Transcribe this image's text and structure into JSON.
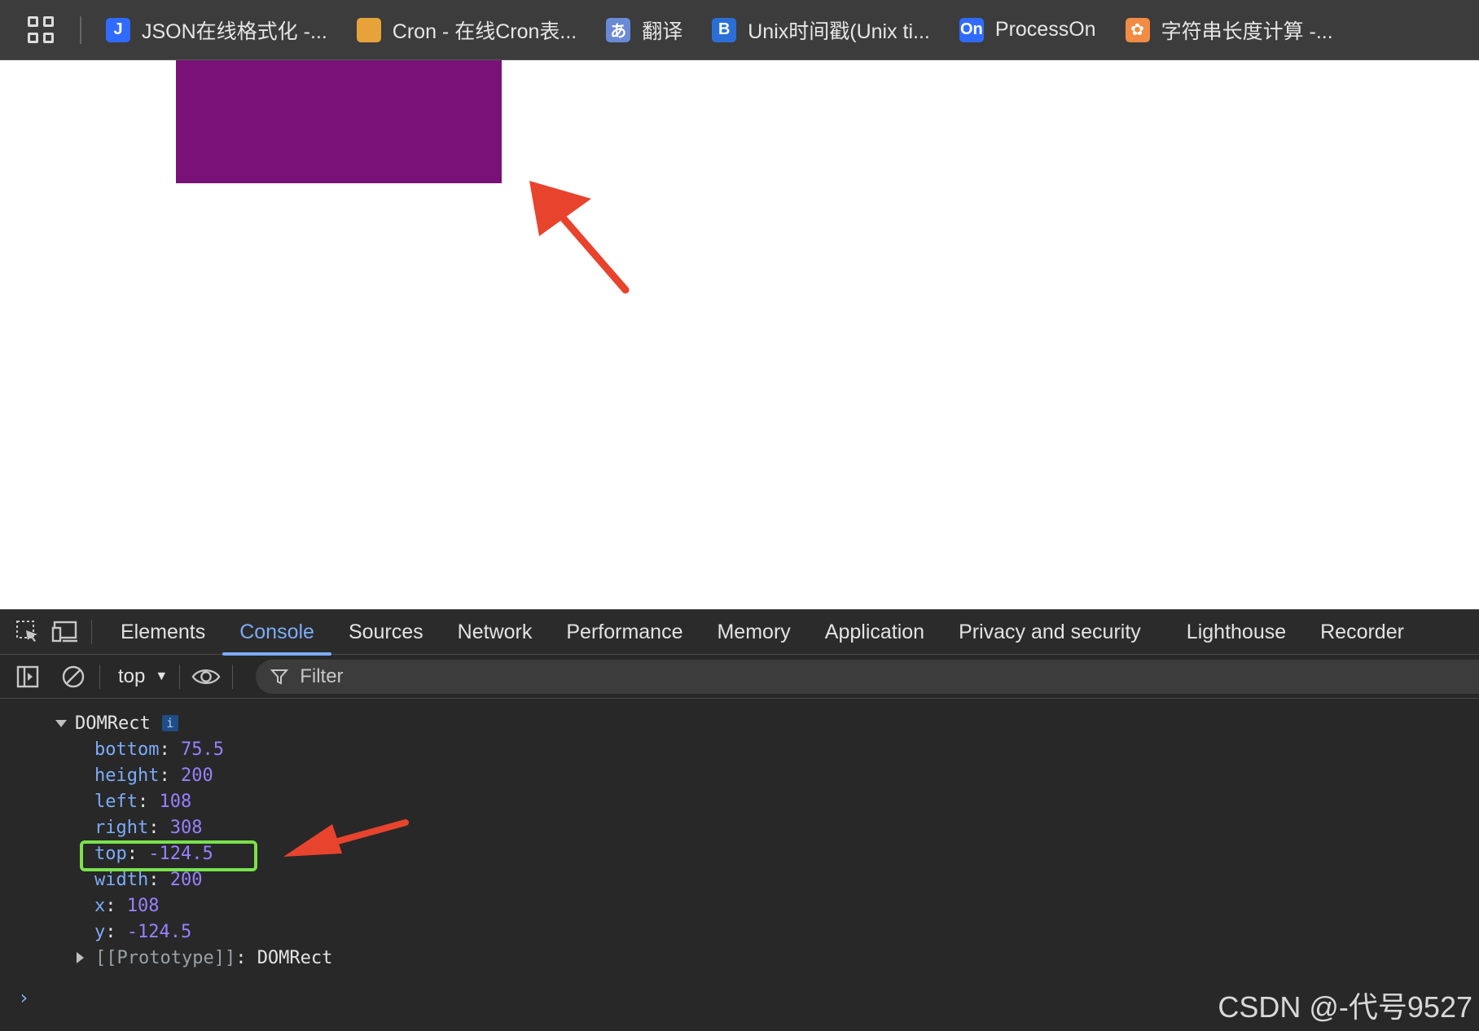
{
  "bookmarks": [
    {
      "label": "JSON在线格式化 -...",
      "icon": "j-logo-icon",
      "icon_text": "J",
      "color": "#2f6bff"
    },
    {
      "label": "Cron - 在线Cron表...",
      "icon": "cookie-icon",
      "icon_text": "",
      "color": "#e8a23a"
    },
    {
      "label": "翻译",
      "icon": "translate-icon",
      "icon_text": "あ",
      "color": "#6b8ad6"
    },
    {
      "label": "Unix时间戳(Unix ti...",
      "icon": "b-logo-icon",
      "icon_text": "B",
      "color": "#2b6fd6"
    },
    {
      "label": "ProcessOn",
      "icon": "on-logo-icon",
      "icon_text": "On",
      "color": "#2f6bff"
    },
    {
      "label": "字符串长度计算 -...",
      "icon": "flower-icon",
      "icon_text": "✿",
      "color": "#f28b43"
    }
  ],
  "page": {
    "box_color": "#7a1178"
  },
  "devtools": {
    "tabs": [
      "Elements",
      "Console",
      "Sources",
      "Network",
      "Performance",
      "Memory",
      "Application",
      "Privacy and security",
      "Lighthouse",
      "Recorder"
    ],
    "active_tab": "Console",
    "context": "top",
    "filter_placeholder": "Filter"
  },
  "console": {
    "object_name": "DOMRect",
    "info_badge": "i",
    "properties": [
      {
        "key": "bottom",
        "value": "75.5"
      },
      {
        "key": "height",
        "value": "200"
      },
      {
        "key": "left",
        "value": "108"
      },
      {
        "key": "right",
        "value": "308"
      },
      {
        "key": "top",
        "value": "-124.5"
      },
      {
        "key": "width",
        "value": "200"
      },
      {
        "key": "x",
        "value": "108"
      },
      {
        "key": "y",
        "value": "-124.5"
      }
    ],
    "prototype_key": "[[Prototype]]",
    "prototype_value": "DOMRect",
    "prompt": "›"
  },
  "annotation": {
    "arrow_color": "#e8432d",
    "highlight_color": "#7ae14d"
  },
  "watermark": "CSDN @-代号9527"
}
